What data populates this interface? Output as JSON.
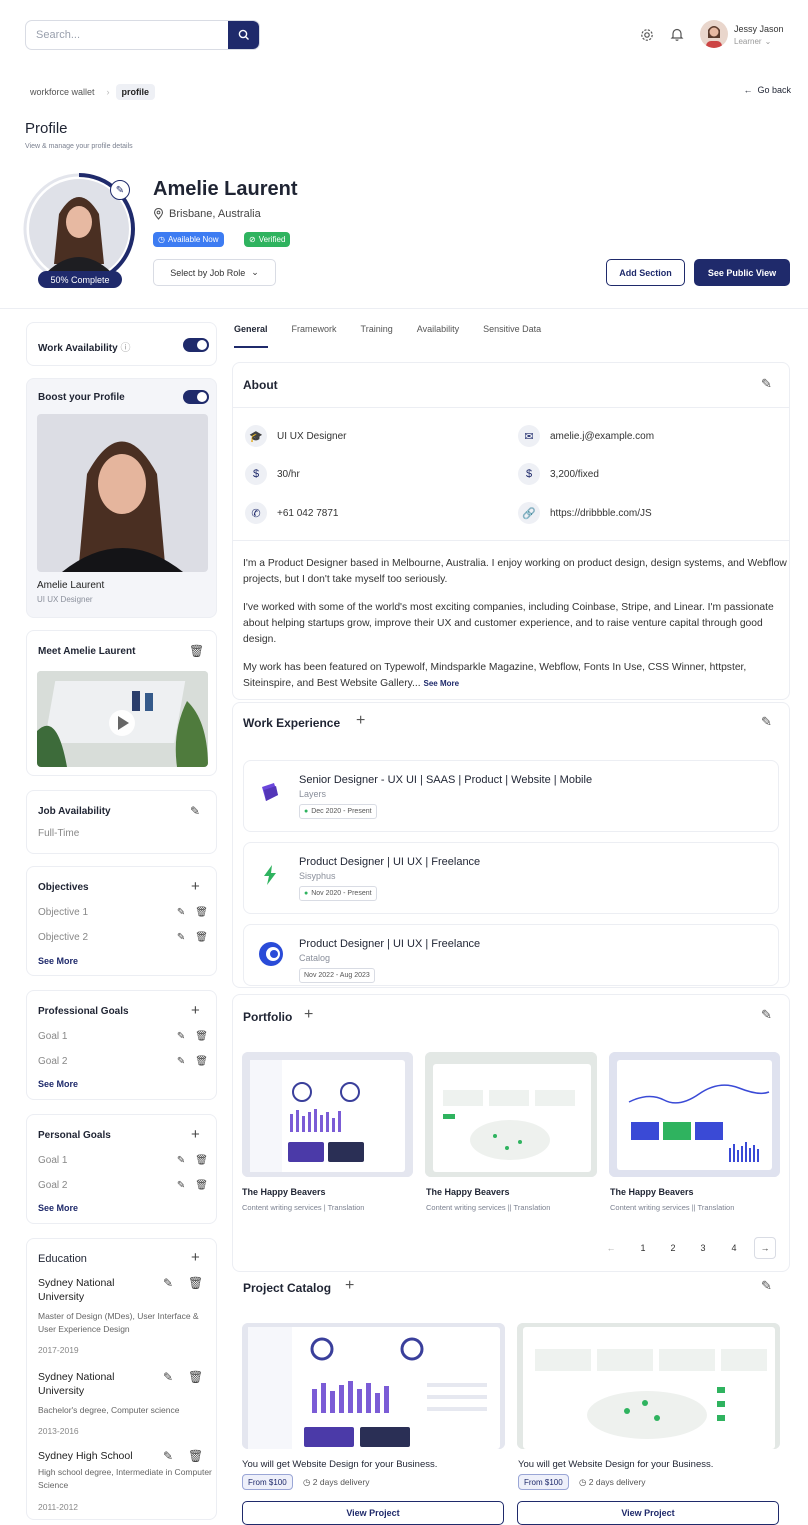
{
  "header": {
    "search_placeholder": "Search...",
    "user_name": "Jessy Jason",
    "user_role": "Learner"
  },
  "breadcrumb": [
    "workforce wallet",
    "profile"
  ],
  "go_back": "Go back",
  "page": {
    "title": "Profile",
    "subtitle": "View & manage your profile details"
  },
  "profile": {
    "name": "Amelie Laurent",
    "location": "Brisbane, Australia",
    "badge_available": "Available Now",
    "badge_verified": "Verified",
    "complete": "50% Complete",
    "complete_fraction": 0.5,
    "job_role_select": "Select by Job Role",
    "add_section": "Add Section",
    "see_public": "See Public View"
  },
  "sidebar": {
    "work_availability": "Work Availability",
    "boost": "Boost your Profile",
    "boost_name": "Amelie Laurent",
    "boost_role": "UI UX Designer",
    "meet": "Meet Amelie Laurent",
    "job_availability": "Job Availability",
    "job_availability_value": "Full-Time",
    "objectives": {
      "title": "Objectives",
      "items": [
        "Objective 1",
        "Objective 2"
      ],
      "see_more": "See More"
    },
    "professional_goals": {
      "title": "Professional Goals",
      "items": [
        "Goal 1",
        "Goal 2"
      ],
      "see_more": "See More"
    },
    "personal_goals": {
      "title": "Personal Goals",
      "items": [
        "Goal 1",
        "Goal 2"
      ],
      "see_more": "See More"
    },
    "education": {
      "title": "Education",
      "items": [
        {
          "school": "Sydney National University",
          "degree": "Master of Design (MDes), User Interface & User Experience Design",
          "years": "2017-2019"
        },
        {
          "school": "Sydney National University",
          "degree": "Bachelor's degree, Computer science",
          "years": "2013-2016"
        },
        {
          "school": "Sydney High School",
          "degree": "High school degree, Intermediate in Computer Science",
          "years": "2011-2012"
        }
      ]
    }
  },
  "tabs": [
    "General",
    "Framework",
    "Training",
    "Availability",
    "Sensitive Data"
  ],
  "about": {
    "title": "About",
    "role": "UI UX Designer",
    "email": "amelie.j@example.com",
    "rate": "30/hr",
    "fixed": "3,200/fixed",
    "phone": "+61 042 7871",
    "website": "https://dribbble.com/JS",
    "p1": "I'm a Product Designer based in Melbourne, Australia. I enjoy working on product design, design systems, and Webflow projects, but I don't take myself too seriously.",
    "p2": "I've worked with some of the world's most exciting companies, including Coinbase, Stripe, and Linear. I'm passionate about helping startups grow, improve their UX and customer experience, and to raise venture capital through good design.",
    "p3": "My work has been featured on Typewolf, Mindsparkle Magazine, Webflow, Fonts In Use, CSS Winner, httpster, Siteinspire, and Best Website Gallery...",
    "see_more": "See More"
  },
  "work_experience": {
    "title": "Work Experience",
    "items": [
      {
        "title": "Senior Designer - UX UI | SAAS | Product | Website | Mobile",
        "company": "Layers",
        "date": "Dec 2020 - Present"
      },
      {
        "title": "Product Designer | UI UX | Freelance",
        "company": "Sisyphus",
        "date": "Nov 2020 - Present"
      },
      {
        "title": "Product Designer | UI UX | Freelance",
        "company": "Catalog",
        "date": "Nov 2022 - Aug 2023"
      }
    ]
  },
  "portfolio": {
    "title": "Portfolio",
    "items": [
      {
        "title": "The Happy Beavers",
        "sub": "Content writing services | Translation"
      },
      {
        "title": "The Happy Beavers",
        "sub": "Content writing services || Translation"
      },
      {
        "title": "The Happy Beavers",
        "sub": "Content writing services || Translation"
      }
    ],
    "pages": [
      "1",
      "2",
      "3",
      "4"
    ]
  },
  "catalog": {
    "title": "Project Catalog",
    "items": [
      {
        "title": "You will get Website Design for your Business.",
        "price": "From $100",
        "delivery": "2 days delivery",
        "button": "View Project"
      },
      {
        "title": "You will get Website Design for your Business.",
        "price": "From $100",
        "delivery": "2 days delivery",
        "button": "View Project"
      }
    ]
  },
  "colors": {
    "primary": "#1f2a6b",
    "available": "#3d7cf2",
    "verified": "#2fb35f"
  }
}
